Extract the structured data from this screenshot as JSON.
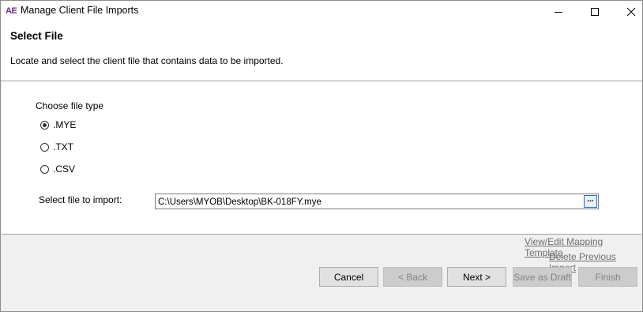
{
  "window": {
    "app_logo": "AE",
    "title": "Manage Client File Imports",
    "icons": {
      "minimize": "minimize-icon",
      "maximize": "maximize-icon",
      "close": "close-icon"
    }
  },
  "header": {
    "title": "Select File",
    "description": "Locate and select the client file that contains data to be imported."
  },
  "file_type": {
    "label": "Choose file type",
    "options": [
      {
        "label": ".MYE",
        "selected": true
      },
      {
        "label": ".TXT",
        "selected": false
      },
      {
        "label": ".CSV",
        "selected": false
      }
    ]
  },
  "file_import": {
    "label": "Select file to import:",
    "value": "C:\\Users\\MYOB\\Desktop\\BK-018FY.mye",
    "browse_label": "..."
  },
  "links": {
    "view_edit": "View/Edit Mapping Template",
    "delete_previous": "Delete Previous Import"
  },
  "buttons": {
    "cancel": "Cancel",
    "back": "< Back",
    "next": "Next >",
    "save_draft": "Save as Draft",
    "finish": "Finish"
  }
}
